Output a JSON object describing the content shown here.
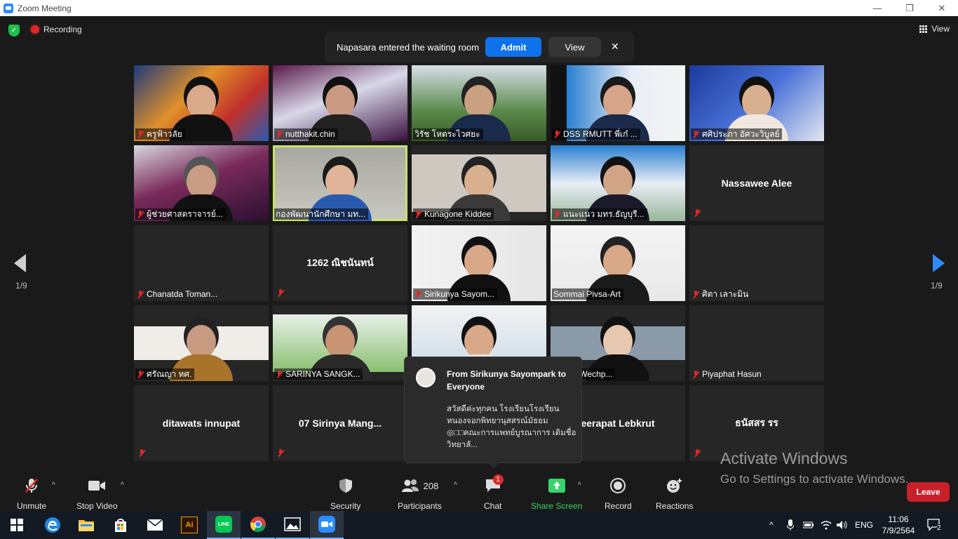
{
  "window": {
    "title": "Zoom Meeting"
  },
  "top": {
    "recording_label": "Recording",
    "view_label": "View"
  },
  "notice": {
    "message": "Napasara entered the waiting room",
    "admit": "Admit",
    "view": "View",
    "close": "✕"
  },
  "gallery": {
    "page_left": "1/9",
    "page_right": "1/9",
    "tiles": [
      {
        "name": "ครูฟ้าวลัย",
        "muted": true,
        "video": true
      },
      {
        "name": "nutthakit.chin",
        "muted": true,
        "video": true
      },
      {
        "name": "วิรัช  โหตระไวศยะ",
        "muted": false,
        "video": true
      },
      {
        "name": "DSS RMUTT พี่เก๋ ...",
        "muted": true,
        "video": true
      },
      {
        "name": "ศศิประภา อัศวะวิบูลย์",
        "muted": true,
        "video": true
      },
      {
        "name": "ผู้ช่วยศาสตราจารย์...",
        "muted": true,
        "video": true
      },
      {
        "name": "กองพัฒนานักศึกษา มท...",
        "muted": false,
        "video": true,
        "active": true
      },
      {
        "name": "Kunagone Kiddee",
        "muted": true,
        "video": true
      },
      {
        "name": "แนะแนว มทร.ธัญบุรี...",
        "muted": true,
        "video": true
      },
      {
        "name": "Nassawee Alee",
        "muted": true,
        "video": false
      },
      {
        "name": "Chanatda Toman...",
        "muted": true,
        "video": false
      },
      {
        "name": "1262 ณิชนันทน์",
        "muted": true,
        "video": false
      },
      {
        "name": "Sirikunya Sayom...",
        "muted": true,
        "video": true
      },
      {
        "name": "Sommai Pivsa-Art",
        "muted": false,
        "video": true
      },
      {
        "name": "ศิตา เลาะมิน",
        "muted": true,
        "video": false
      },
      {
        "name": "ศรัณญา หศ.",
        "muted": true,
        "video": true
      },
      {
        "name": "SARINYA SANGK...",
        "muted": true,
        "video": true
      },
      {
        "name": "",
        "muted": false,
        "video": true
      },
      {
        "name": "Praiya Wechp...",
        "muted": false,
        "video": true
      },
      {
        "name": "Piyaphat Hasun",
        "muted": true,
        "video": false
      },
      {
        "name": "ditawats innupat",
        "muted": true,
        "video": false
      },
      {
        "name": "07  Sirinya Mang...",
        "muted": true,
        "video": false
      },
      {
        "name": "",
        "muted": false,
        "video": false
      },
      {
        "name": "eerapat Lebkrut",
        "muted": false,
        "video": false
      },
      {
        "name": "ธนัสสร รร",
        "muted": true,
        "video": false
      }
    ]
  },
  "chat_popup": {
    "from": "From Sirikunya Sayompark to Everyone",
    "text": "สวัสดีค่ะทุกคน  โรงเรียนโรงเรียนหนองจอกพิทยานุสสรณ์มัธยม ◎□□คณะการแพทย์บูรณาการ เดิมชื่อ วิทยาลั..."
  },
  "watermark": {
    "line1": "Activate Windows",
    "line2": "Go to Settings to activate Windows."
  },
  "toolbar": {
    "unmute": "Unmute",
    "stop_video": "Stop Video",
    "security": "Security",
    "participants": "Participants",
    "participants_count": "208",
    "chat": "Chat",
    "chat_badge": "1",
    "share_screen": "Share Screen",
    "record": "Record",
    "reactions": "Reactions",
    "leave": "Leave"
  },
  "taskbar": {
    "lang": "ENG",
    "time": "11:06",
    "date": "7/9/2564",
    "notifications": "2"
  },
  "colors": {
    "zoom_blue": "#0e72ed",
    "share_green": "#38d36b",
    "leave_red": "#c8202a",
    "active_outline": "#c8e36a"
  }
}
